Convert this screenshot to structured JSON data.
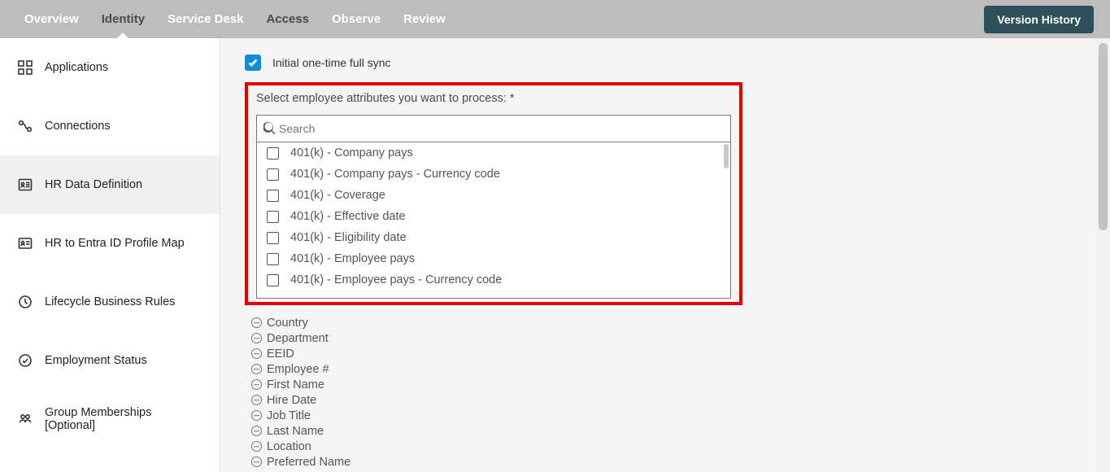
{
  "topnav": {
    "tabs": [
      {
        "label": "Overview",
        "dim": false
      },
      {
        "label": "Identity",
        "dim": true,
        "active": true
      },
      {
        "label": "Service Desk",
        "dim": false
      },
      {
        "label": "Access",
        "dim": true
      },
      {
        "label": "Observe",
        "dim": false
      },
      {
        "label": "Review",
        "dim": false
      }
    ],
    "version_btn": "Version History"
  },
  "sidebar": {
    "items": [
      {
        "icon": "apps",
        "label": "Applications"
      },
      {
        "icon": "connections",
        "label": "Connections"
      },
      {
        "icon": "hr-data",
        "label": "HR Data Definition",
        "active": true
      },
      {
        "icon": "profile-map",
        "label": "HR to Entra ID Profile Map"
      },
      {
        "icon": "lifecycle",
        "label": "Lifecycle Business Rules"
      },
      {
        "icon": "emp-status",
        "label": "Employment Status"
      },
      {
        "icon": "groups",
        "label": "Group Memberships [Optional]"
      }
    ]
  },
  "main": {
    "sync_label": "Initial one-time full sync",
    "attr_prompt": "Select employee attributes you want to process: *",
    "search_placeholder": "Search",
    "attr_options": [
      "401(k) - Company pays",
      "401(k) - Company pays - Currency code",
      "401(k) - Coverage",
      "401(k) - Effective date",
      "401(k) - Eligibility date",
      "401(k) - Employee pays",
      "401(k) - Employee pays - Currency code"
    ],
    "selected_attrs": [
      "Country",
      "Department",
      "EEID",
      "Employee #",
      "First Name",
      "Hire Date",
      "Job Title",
      "Last Name",
      "Location",
      "Preferred Name"
    ]
  }
}
